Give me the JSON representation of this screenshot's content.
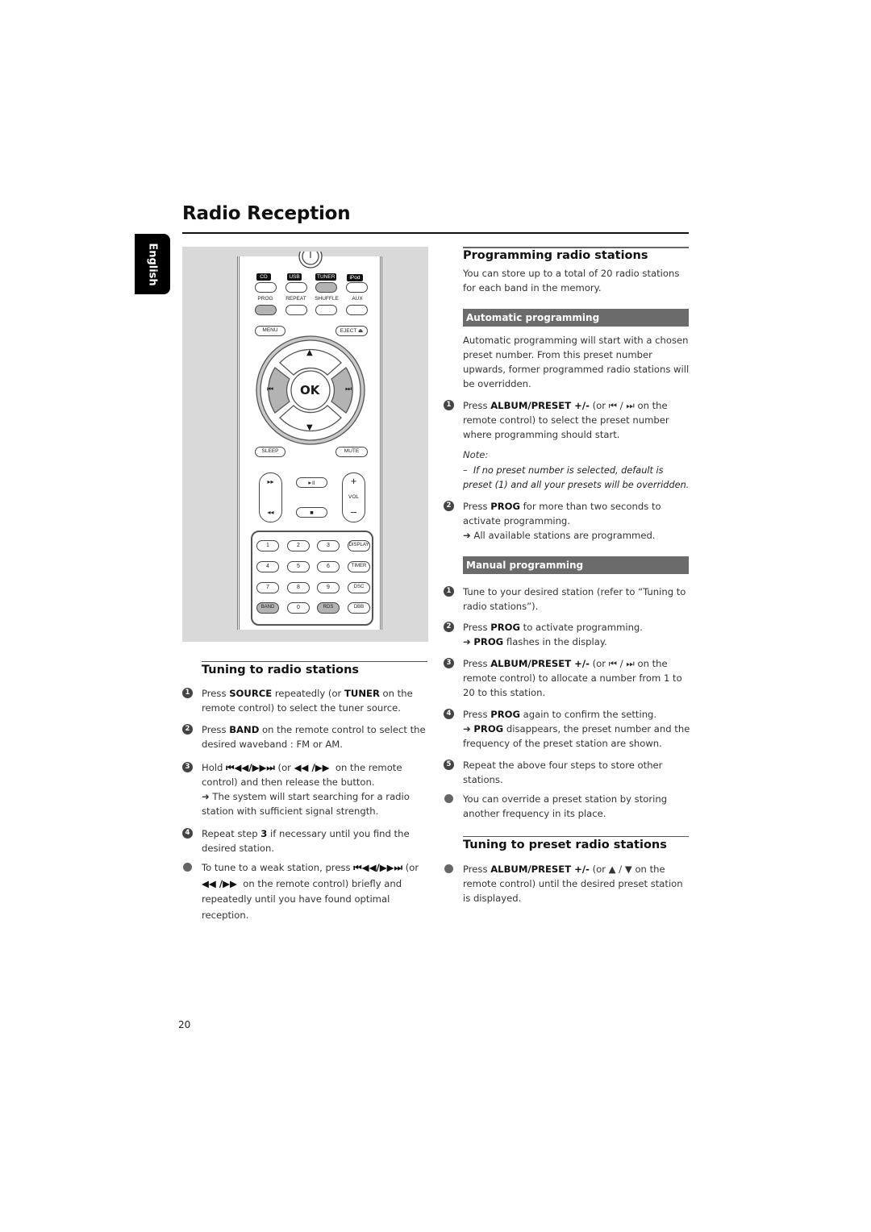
{
  "page": {
    "title": "Radio Reception",
    "language_tab": "English",
    "page_number": "20"
  },
  "remote": {
    "source_tags": [
      "CD",
      "USB",
      "TUNER",
      "iPod"
    ],
    "row2_labels": [
      "PROG",
      "REPEAT",
      "SHUFFLE",
      "AUX"
    ],
    "menu": "MENU",
    "eject": "EJECT ⏏",
    "ok": "OK",
    "up": "▲",
    "down": "▼",
    "prev": "⏮",
    "next": "⏭",
    "sleep": "SLEEP",
    "mute": "MUTE",
    "ffwd": "▸▸",
    "rew": "◂◂",
    "play_pause": "▸॥",
    "stop": "■",
    "vol_plus": "+",
    "vol_label": "VOL",
    "vol_minus": "–",
    "keypad": [
      [
        "1",
        "2",
        "3",
        "DISPLAY"
      ],
      [
        "4",
        "5",
        "6",
        "TIMER"
      ],
      [
        "7",
        "8",
        "9",
        "DSC"
      ],
      [
        "BAND",
        "0",
        "RDS",
        "DBB"
      ]
    ],
    "highlighted_keys": [
      "TUNER",
      "PROG",
      "BAND",
      "RDS",
      "prev",
      "next"
    ]
  },
  "tuning": {
    "heading": "Tuning to radio stations",
    "steps": [
      {
        "marker": "1",
        "html": "Press <b>SOURCE</b> repeatedly (or <b>TUNER</b> on the remote control) to select the tuner source."
      },
      {
        "marker": "2",
        "html": "Press <b>BAND</b> on the remote control to select the desired waveband : FM or AM."
      },
      {
        "marker": "3",
        "html": "Hold <b>⏮◀◀/▶▶⏭</b> (or <b>◀◀ /▶▶</b>&nbsp; on the remote control) and then release the button.<br>➜ The system will start searching for a radio station with sufficient signal strength."
      },
      {
        "marker": "4",
        "html": "Repeat step <b>3</b> if necessary until you find the desired station."
      },
      {
        "marker": "•",
        "html": "To tune to a weak station, press <b>⏮◀◀/▶▶⏭</b> (or <b>◀◀ /▶▶</b>&nbsp; on the remote control) briefly and repeatedly until you have found optimal reception."
      }
    ]
  },
  "programming": {
    "heading": "Programming radio stations",
    "intro": "You can store up to a total of 20 radio stations for each band in the memory.",
    "automatic": {
      "heading": "Automatic programming",
      "intro": "Automatic programming will start with a chosen preset number. From this preset number upwards, former programmed radio stations will be overridden.",
      "step1": "Press <b>ALBUM/PRESET +/-</b> (or ⏮ / ⏭ on the remote control) to select the preset number where programming should start.",
      "note_label": "Note:",
      "note_text": "–&nbsp; If no preset number is selected, default is preset (1) and all your presets will be overridden.",
      "step2": "Press <b>PROG</b> for more than two seconds to activate programming.<br>➜ All available stations are programmed."
    },
    "manual": {
      "heading": "Manual programming",
      "steps": [
        {
          "marker": "1",
          "html": "Tune to your desired station (refer to “Tuning to radio stations”)."
        },
        {
          "marker": "2",
          "html": "Press <b>PROG</b> to activate programming.<br>➜ <b>PROG</b> flashes in the display."
        },
        {
          "marker": "3",
          "html": "Press <b>ALBUM/PRESET +/-</b> (or ⏮ / ⏭ on the remote control) to allocate a number from 1 to 20 to this station."
        },
        {
          "marker": "4",
          "html": "Press <b>PROG</b> again to confirm the setting.<br>➜ <b>PROG</b> disappears, the preset number and the frequency of the preset station are shown."
        },
        {
          "marker": "5",
          "html": "Repeat the above four steps to store other stations."
        },
        {
          "marker": "•",
          "html": "You can override a preset station by storing another frequency in its place."
        }
      ]
    }
  },
  "preset_tuning": {
    "heading": "Tuning to preset radio stations",
    "steps": [
      {
        "marker": "•",
        "html": "Press <b>ALBUM/PRESET +/-</b> (or ▲ / ▼ on the remote control) until the desired preset station is displayed."
      }
    ]
  }
}
